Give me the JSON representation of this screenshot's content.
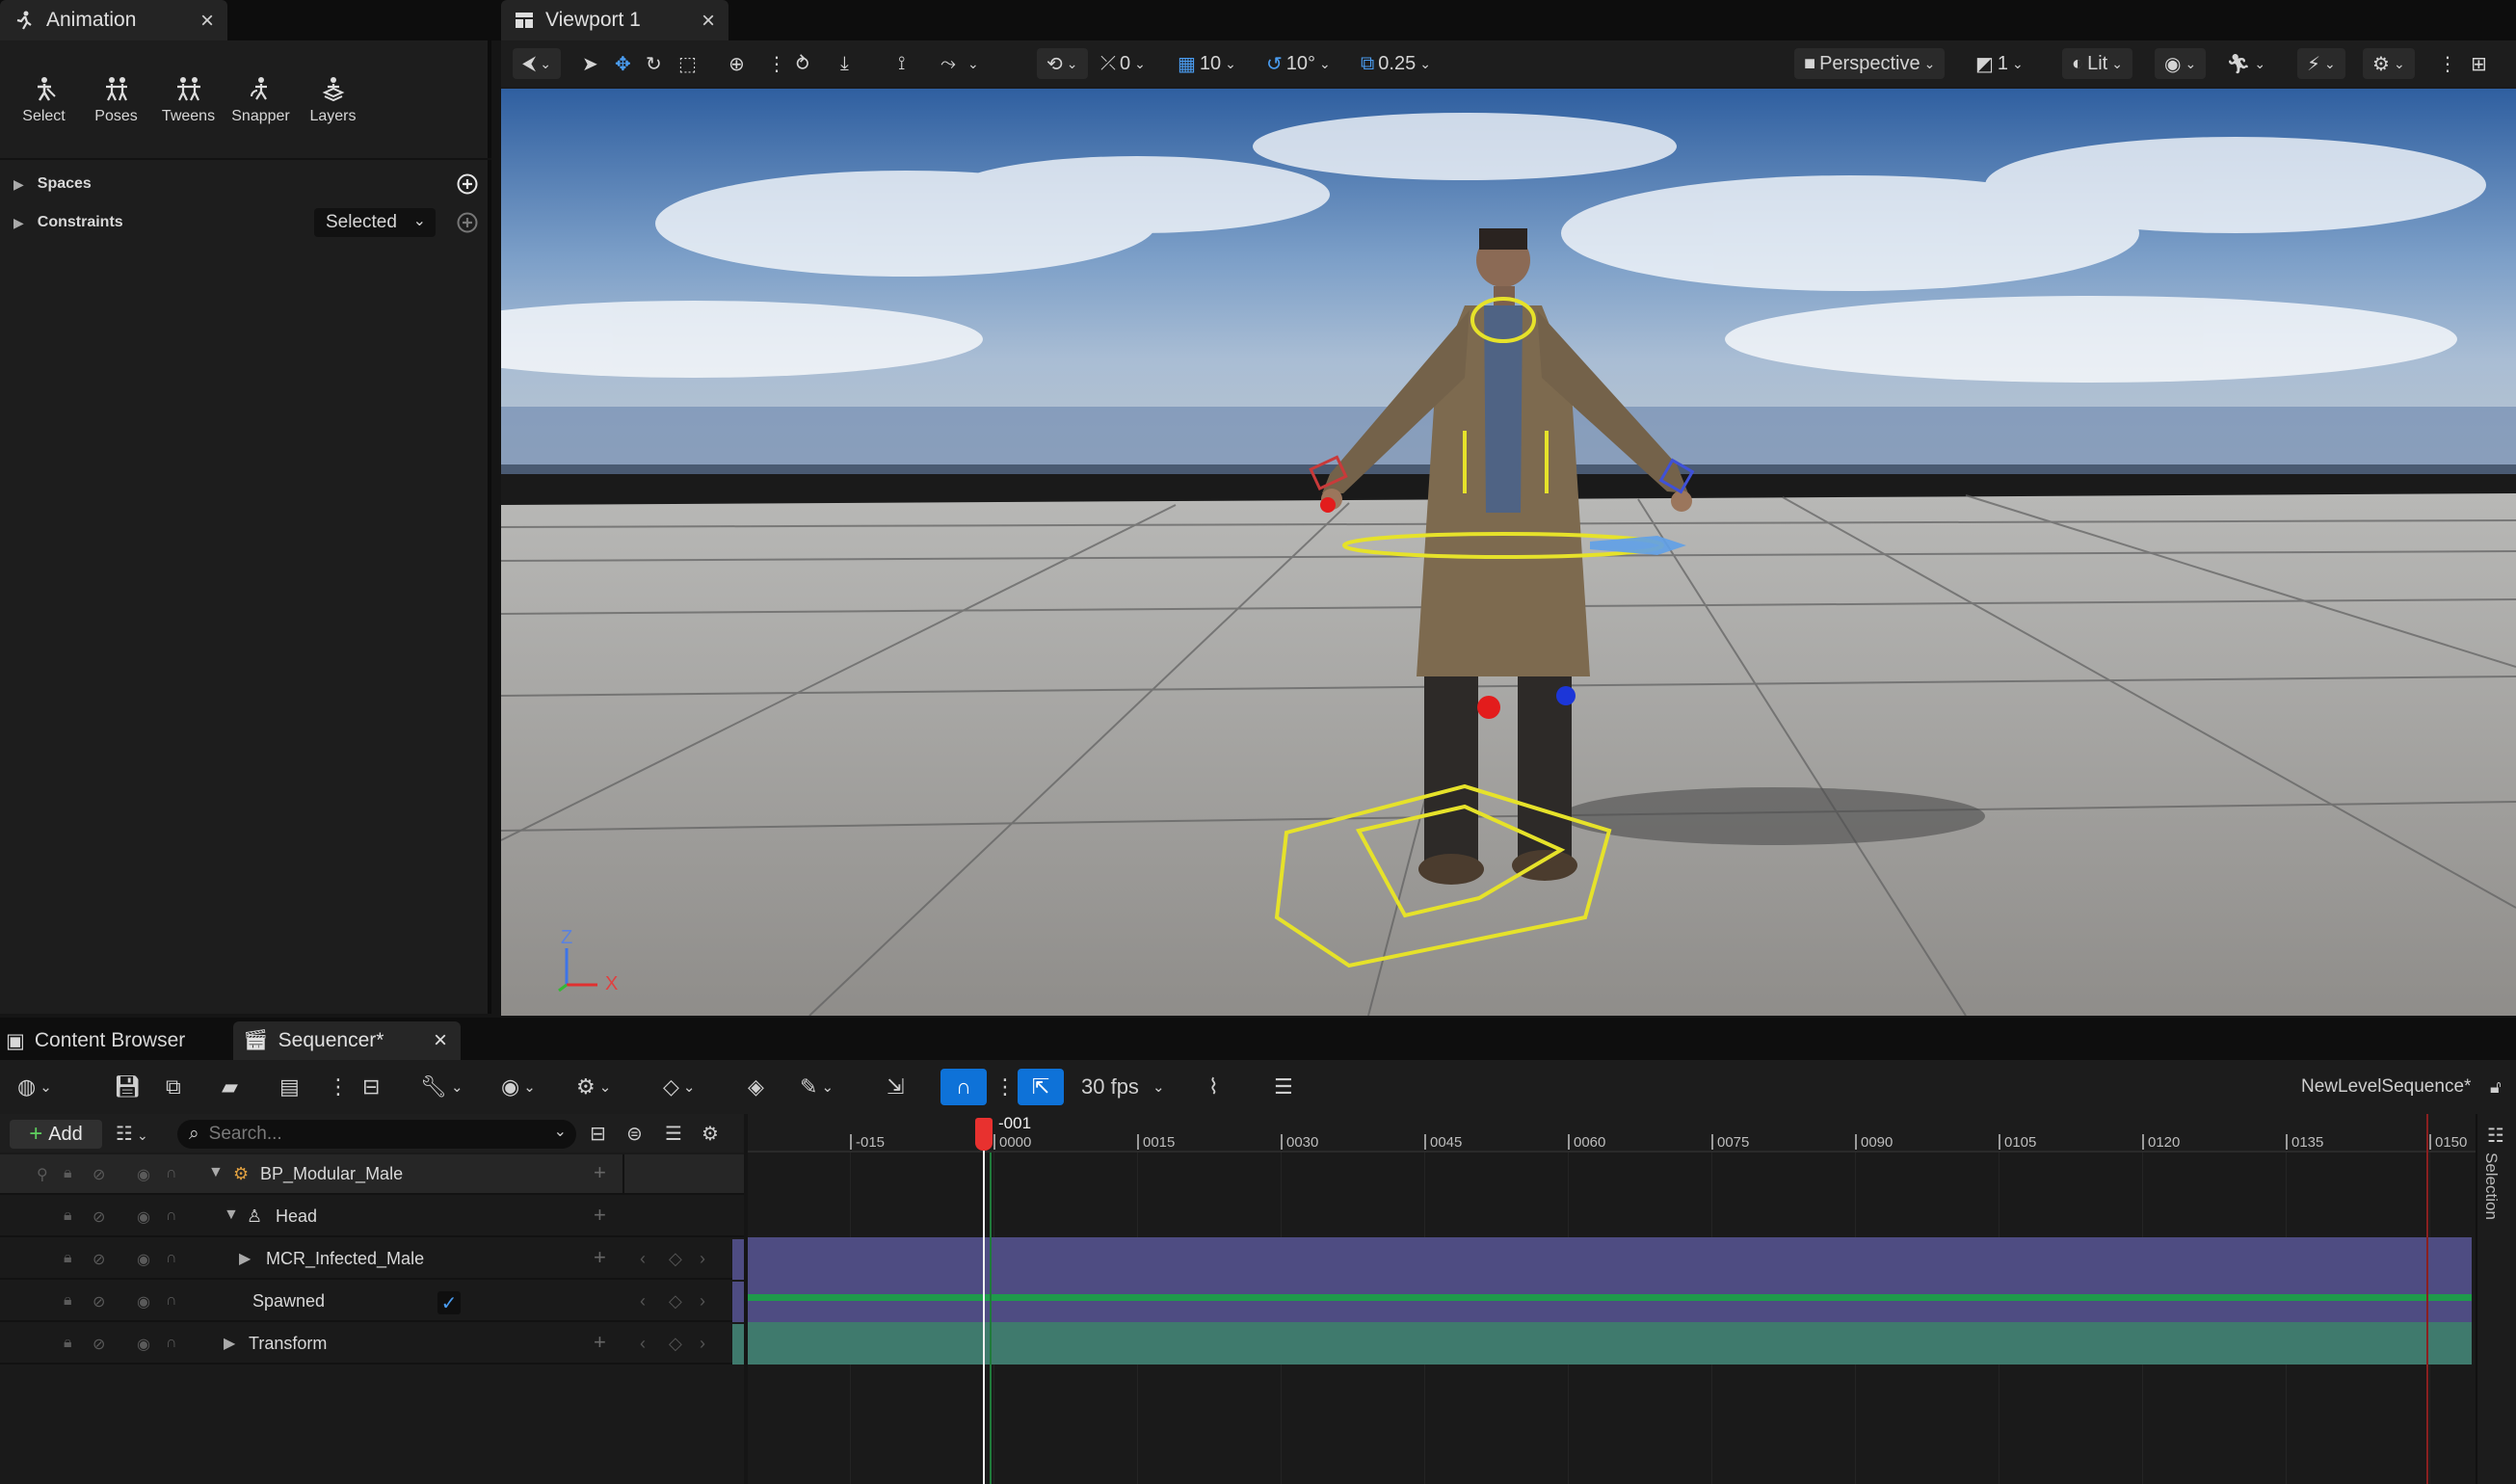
{
  "animation_tab": {
    "title": "Animation"
  },
  "anim_tools": [
    {
      "label": "Select",
      "icon": "select-icon"
    },
    {
      "label": "Poses",
      "icon": "poses-icon"
    },
    {
      "label": "Tweens",
      "icon": "tweens-icon"
    },
    {
      "label": "Snapper",
      "icon": "snapper-icon"
    },
    {
      "label": "Layers",
      "icon": "layers-icon"
    }
  ],
  "spaces": {
    "label": "Spaces"
  },
  "constraints": {
    "label": "Constraints",
    "dropdown_value": "Selected"
  },
  "viewport_tab": {
    "title": "Viewport 1"
  },
  "viewport_toolbar": {
    "rotation_snap_value": "0",
    "grid_snap_value": "10",
    "angle_snap_value": "10°",
    "scale_snap_value": "0.25",
    "perspective_label": "Perspective",
    "layout_value": "1",
    "lit_label": "Lit"
  },
  "axis": {
    "z": "Z",
    "x": "X"
  },
  "bottom_tabs": {
    "content_browser": "Content Browser",
    "sequencer": "Sequencer*"
  },
  "sequencer_toolbar": {
    "fps": "30 fps",
    "sequence_name": "NewLevelSequence*"
  },
  "outliner": {
    "add_label": "Add",
    "search_placeholder": "Search...",
    "rows": [
      {
        "label": "BP_Modular_Male"
      },
      {
        "label": "Head"
      },
      {
        "label": "MCR_Infected_Male"
      },
      {
        "label": "Spawned"
      },
      {
        "label": "Transform"
      }
    ]
  },
  "timeline": {
    "playhead_label": "-001",
    "ticks": [
      "-015",
      "0000",
      "0015",
      "0030",
      "0045",
      "0060",
      "0075",
      "0090",
      "0105",
      "0120",
      "0135",
      "0150"
    ]
  },
  "side_strip": {
    "label": "Selection"
  },
  "colors": {
    "accent_blue": "#0e72d8",
    "track_purple": "#4e4c82",
    "track_teal": "#3f7a6d",
    "spawned_green": "#1f9a4b",
    "playhead_red": "#e8312f"
  }
}
